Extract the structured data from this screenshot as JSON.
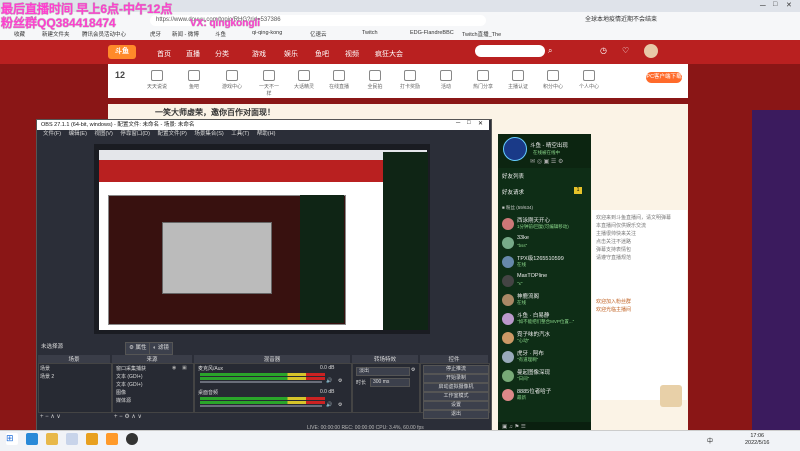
{
  "overlay": {
    "line1": "最后直播时间 早上6点-中午12点",
    "line2": "粉丝群QQ384418474",
    "wechat": "VX: qingkongli"
  },
  "browser": {
    "url": "https://www.douyu.com/topic/RHG?rid=537386",
    "news": "全球本地疫情近期不会结束",
    "bookmarks": [
      "收藏",
      "新建文件夹",
      "腾讯会员活动中心",
      "虎牙",
      "新闻 - 微博",
      "斗鱼",
      "qi-qing-kong",
      "亿速云",
      "Twitch",
      "EDG-FlandreBBC",
      "Twitch直播_The"
    ]
  },
  "site": {
    "logo": "斗鱼",
    "nav": [
      "首页",
      "直播",
      "分类",
      "游戏",
      "娱乐",
      "鱼吧",
      "视频",
      "疯狂大会"
    ],
    "date_num": "12",
    "categories": [
      "天天说说",
      "鱼吧",
      "游戏中心",
      "一天不一样",
      "大话精灵",
      "在线直播",
      "全民拍",
      "打卡奖励",
      "活动",
      "热门分享",
      "主播认证",
      "积分中心",
      "个人中心"
    ],
    "pc_button": "PC客户端下载",
    "banner": "一笑大师虚荣，邀你百作对面现！",
    "right_lines": [
      "欢迎来到斗鱼直播间，请文明弹幕",
      "本直播间仅供娱乐交流",
      "主播很帅快来关注",
      "点击关注不迷路",
      "弹幕支持表情包",
      "请遵守直播规范"
    ],
    "right_link1": "欢迎加入粉丝群",
    "right_link2": "欢迎光临主播间"
  },
  "obs": {
    "title": "OBS 27.1.1 (64-bit, windows) - 配置文件: 未命名 - 场景: 未命名",
    "menu": [
      "文件(F)",
      "编辑(E)",
      "视图(V)",
      "停靠窗口(D)",
      "配置文件(P)",
      "场景集合(S)",
      "工具(T)",
      "帮助(H)"
    ],
    "source_status": "未选择源",
    "props_btn": "属性",
    "filters_btn": "滤镜",
    "scenes_header": "场景",
    "scenes": [
      "场景",
      "场景 2"
    ],
    "sources_header": "来源",
    "sources": [
      "窗口采集捕获",
      "文本 (GDI+)",
      "文本 (GDI+)",
      "图像",
      "媒体源"
    ],
    "mixer_header": "混音器",
    "mixer_tracks": [
      {
        "name": "麦克风/Aux",
        "db": "0.0 dB"
      },
      {
        "name": "桌面音频",
        "db": "0.0 dB"
      }
    ],
    "transitions_header": "转场特效",
    "transition_type": "淡出",
    "duration_label": "时长",
    "duration_value": "300 ms",
    "controls_header": "控件",
    "controls": [
      "停止推流",
      "开始录制",
      "启动虚拟摄像机",
      "工作室模式",
      "设置",
      "退出"
    ],
    "status": "LIVE: 00:00:00   REC: 00:00:00   CPU: 3.4%, 60.00 fps"
  },
  "chat": {
    "title": "斗鱼 - 晴空出现",
    "subtitle": "在线被在线中",
    "friends_label": "好友列表",
    "requests_label": "好友请求",
    "requests_count": "1",
    "group_label": "■ 粉丝 (59/634)",
    "users": [
      {
        "name": "西泳刚天开心",
        "msg": "1分钟前/回复(可编辑移动)"
      },
      {
        "name": "33ke",
        "msg": "\"bss\""
      },
      {
        "name": "TPX级1265510599",
        "msg": "在线"
      },
      {
        "name": "MaxTOPline",
        "msg": "\"x\""
      },
      {
        "name": "神鹿流阁",
        "msg": "在线"
      },
      {
        "name": "斗鱼 · 白易静",
        "msg": "\"如不能把们整合MVP位置...\""
      },
      {
        "name": "霓子味的汽水",
        "msg": "\"心动\""
      },
      {
        "name": "虎牙 · 阿布",
        "msg": "\"有道理啊\""
      },
      {
        "name": "曼起图像深现",
        "msg": "\"日间\""
      },
      {
        "name": "8885位者哈子",
        "msg": "最新"
      }
    ]
  },
  "taskbar": {
    "ime": "中",
    "time": "17:06",
    "date": "2022/5/16"
  }
}
